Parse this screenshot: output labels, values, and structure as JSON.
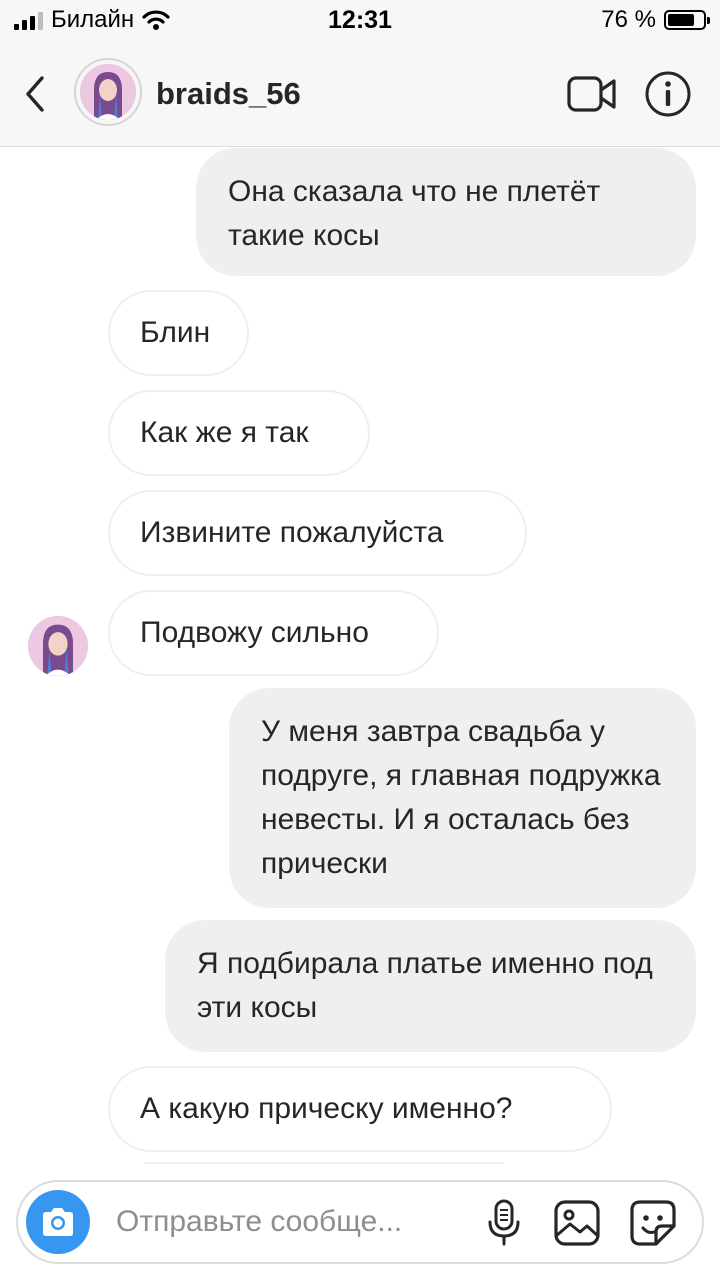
{
  "status_bar": {
    "carrier": "Билайн",
    "time": "12:31",
    "battery": "76 %",
    "battery_level": 0.76,
    "icons": [
      "signal-icon",
      "wifi-icon",
      "battery-icon"
    ]
  },
  "header": {
    "username": "braids_56",
    "icons": [
      "back-chevron-icon",
      "avatar",
      "video-call-icon",
      "info-icon"
    ]
  },
  "messages": [
    {
      "side": "outgoing",
      "text": "Она сказала что не плетёт такие косы"
    },
    {
      "side": "incoming",
      "text": "Блин"
    },
    {
      "side": "incoming",
      "text": "Как же я так"
    },
    {
      "side": "incoming",
      "text": "Извините пожалуйста"
    },
    {
      "side": "incoming",
      "text": "Подвожу сильно"
    },
    {
      "side": "outgoing",
      "text": "У меня завтра свадьба у подруге, я главная подружка невесты. И я осталась без прически"
    },
    {
      "side": "outgoing",
      "text": "Я подбирала платье именно под эти косы"
    },
    {
      "side": "incoming",
      "text": "А какую прическу именно?"
    }
  ],
  "composer": {
    "placeholder": "Отправьте сообще...",
    "icons": [
      "camera-icon",
      "microphone-icon",
      "gallery-icon",
      "sticker-icon"
    ]
  },
  "colors": {
    "accent": "#3797f0",
    "outgoing_bubble": "#efefef",
    "incoming_border": "#efefef",
    "header_bg": "#f7f7f7"
  }
}
